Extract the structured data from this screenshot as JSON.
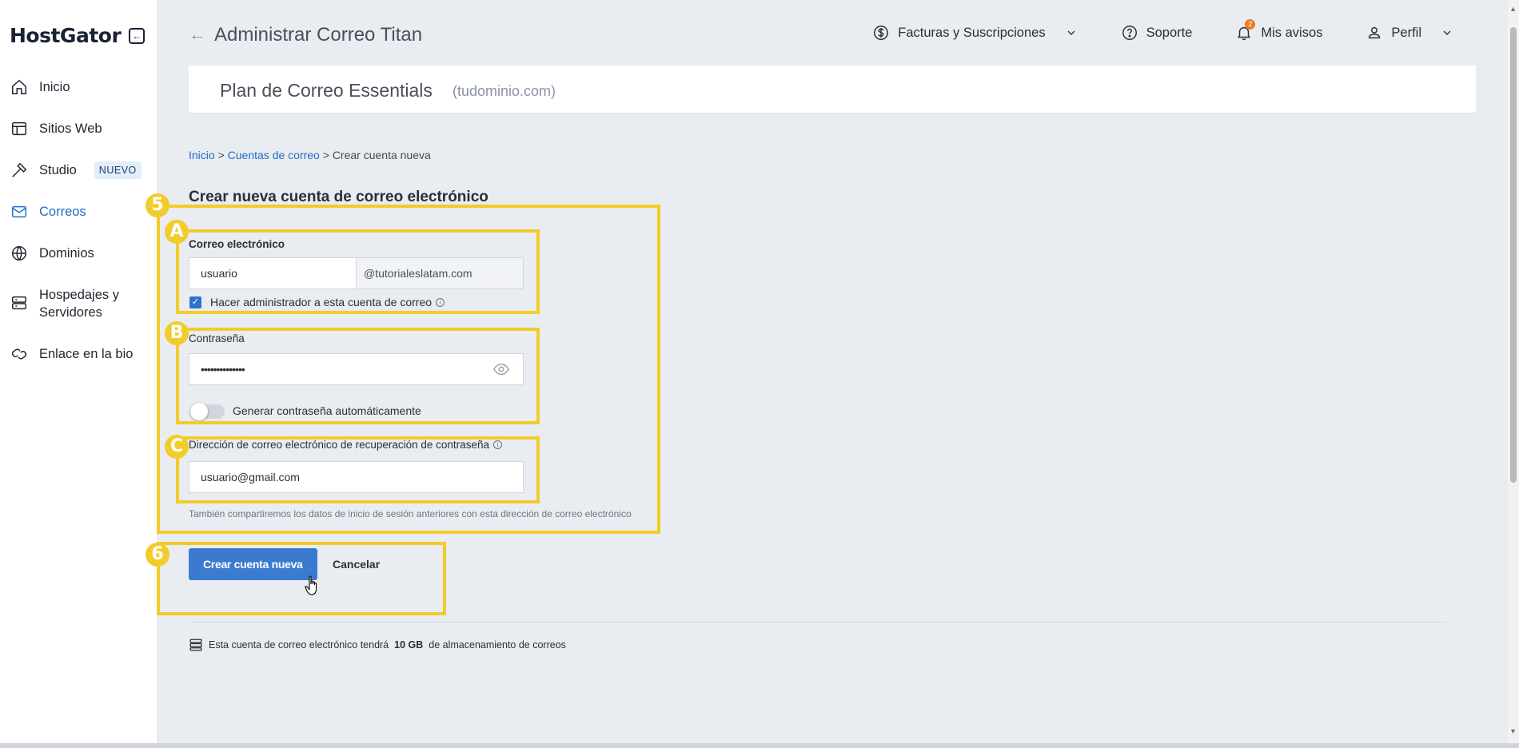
{
  "sidebar": {
    "logo": "HostGator",
    "collapse_icon": "collapse-left-icon",
    "items": [
      {
        "label": "Inicio",
        "icon": "home-icon"
      },
      {
        "label": "Sitios Web",
        "icon": "layout-icon"
      },
      {
        "label": "Studio",
        "icon": "studio-icon",
        "badge": "NUEVO"
      },
      {
        "label": "Correos",
        "icon": "mail-icon",
        "active": true
      },
      {
        "label": "Dominios",
        "icon": "globe-icon"
      },
      {
        "label": "Hospedajes y Servidores",
        "line1": "Hospedajes y",
        "line2": "Servidores",
        "icon": "server-icon"
      },
      {
        "label": "Enlace en la bio",
        "icon": "link-icon"
      }
    ]
  },
  "header": {
    "title": "Administrar Correo Titan",
    "billing": "Facturas y Suscripciones",
    "support": "Soporte",
    "notices": "Mis avisos",
    "notices_count": "2",
    "profile": "Perfil"
  },
  "plan": {
    "title": "Plan de Correo Essentials",
    "domain": "(tudominio.com)"
  },
  "breadcrumb": {
    "home": "Inicio",
    "sep1": ">",
    "accounts": "Cuentas de correo",
    "sep2": ">",
    "current": "Crear cuenta nueva"
  },
  "form": {
    "title": "Crear nueva cuenta de correo electrónico",
    "email_label": "Correo electrónico",
    "email_value": "usuario",
    "email_domain": "@tutorialeslatam.com",
    "admin_checkbox_label": "Hacer administrador a esta cuenta de correo",
    "admin_checked": true,
    "password_label": "Contraseña",
    "password_value": "••••••••••••••",
    "auto_password_label": "Generar contraseña automáticamente",
    "auto_password_on": false,
    "recovery_label": "Dirección de correo electrónico de recuperación de contraseña",
    "recovery_value": "usuario@gmail.com",
    "recovery_hint": "También compartiremos los datos de inicio de sesión anteriores con esta dirección de correo electrónico",
    "submit_label": "Crear cuenta nueva",
    "cancel_label": "Cancelar"
  },
  "storage": {
    "prefix": "Esta cuenta de correo electrónico tendrá",
    "amount": "10 GB",
    "suffix": "de almacenamiento de correos"
  },
  "annotations": {
    "step5": "5",
    "stepA": "A",
    "stepB": "B",
    "stepC": "C",
    "step6": "6",
    "color": "#f2cc2a"
  },
  "colors": {
    "accent": "#1f6fc2",
    "primary_button": "#3a7bd0",
    "background": "#e9ecf1"
  }
}
